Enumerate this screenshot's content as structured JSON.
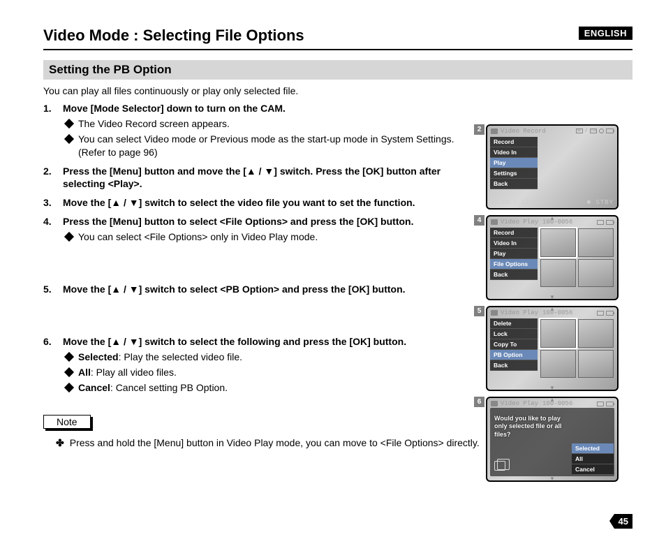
{
  "language_badge": "ENGLISH",
  "title": "Video Mode : Selecting File Options",
  "subtitle": "Setting the PB Option",
  "intro": "You can play all files continuously or play only selected file.",
  "steps": {
    "s1": {
      "num": "1.",
      "head": "Move [Mode Selector] down to turn on the CAM.",
      "sub1": "The Video Record screen appears.",
      "sub2": "You can select Video mode or Previous mode as the start-up mode in System Settings. (Refer to page 96)"
    },
    "s2": {
      "num": "2.",
      "head_a": "Press the [Menu] button and move the [",
      "head_b": "] switch. Press the [OK] button after selecting <Play>."
    },
    "s3": {
      "num": "3.",
      "head_a": "Move the [",
      "head_b": "] switch to select the video file you want to set the function."
    },
    "s4": {
      "num": "4.",
      "head": "Press the [Menu] button to select <File Options> and press the [OK] button.",
      "sub1": "You can select <File Options> only in Video Play mode."
    },
    "s5": {
      "num": "5.",
      "head_a": "Move the [",
      "head_b": "] switch to select <PB Option> and press the [OK] button."
    },
    "s6": {
      "num": "6.",
      "head_a": "Move the [",
      "head_b": "] switch to select the following and press the [OK] button.",
      "opt1_b": "Selected",
      "opt1_t": ": Play the selected video file.",
      "opt2_b": "All",
      "opt2_t": ": Play all video files.",
      "opt3_b": "Cancel",
      "opt3_t": ": Cancel setting PB Option."
    }
  },
  "updown_glyph": "▲ / ▼",
  "note_label": "Note",
  "note_bullet": "✤",
  "note_text": "Press and hold the [Menu] button in Video Play mode, you can move to <File Options> directly.",
  "page_number": "45",
  "screens": {
    "sc2": {
      "tag": "2",
      "header": "Video Record",
      "badge1": "SF",
      "slash": "/",
      "badge2": "720",
      "menu": [
        "Record",
        "Video In",
        "Play",
        "Settings",
        "Back"
      ],
      "selected_index": 2,
      "time_left": "00:00 / 10:57",
      "time_right": "STBY"
    },
    "sc4": {
      "tag": "4",
      "header": "Video Play",
      "file_id": "100-0056",
      "menu": [
        "Record",
        "Video In",
        "Play",
        "File Options",
        "Back"
      ],
      "selected_index": 3
    },
    "sc5": {
      "tag": "5",
      "header": "Video Play",
      "file_id": "100-0056",
      "menu": [
        "Delete",
        "Lock",
        "Copy To",
        "PB Option",
        "Back"
      ],
      "selected_index": 3
    },
    "sc6": {
      "tag": "6",
      "header": "Video Play",
      "file_id": "100-0056",
      "question": "Would you like to play only selected file or all files?",
      "menu": [
        "Selected",
        "All",
        "Cancel"
      ],
      "selected_index": 0
    }
  }
}
